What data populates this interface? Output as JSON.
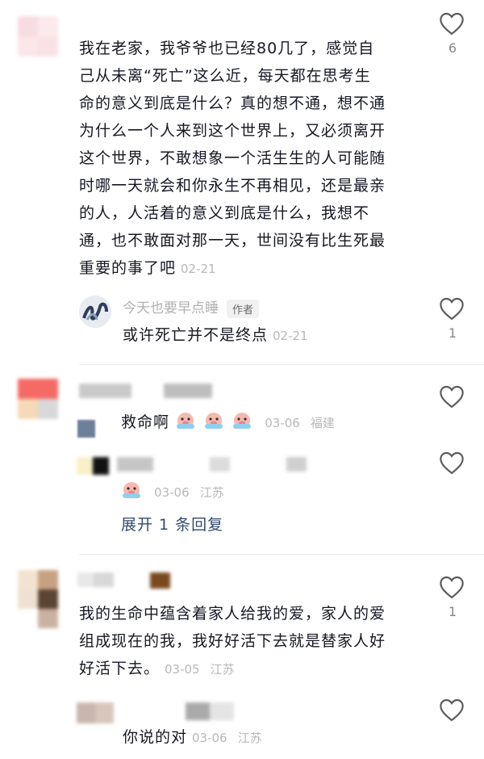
{
  "comments": [
    {
      "text_lines": [
        "我在老家，我爷爷也已经80几了，感觉自",
        "己从未离“死亡”这么近，每天都在思考生",
        "命的意义到底是什么？真的想不通，想不通",
        "为什么一个人来到这个世界上，又必须离开",
        "这个世界，不敢想象一个活生生的人可能随",
        "时哪一天就会和你永生不再相见，还是最亲",
        "的人，人活着的意义到底是什么，我想不",
        "通，也不敢面对那一天，世间没有比生死最",
        "重要的事了吧"
      ],
      "time": "02-21",
      "likes": "6",
      "reply": {
        "username": "今天也要早点睡",
        "tag": "作者",
        "text": "或许死亡并不是终点",
        "time": "02-21",
        "likes": "1"
      }
    },
    {
      "text": "救命啊",
      "time": "03-06",
      "location": "福建",
      "emoji": "crying-pig-emoji",
      "reply": {
        "time": "03-06",
        "location": "江苏",
        "emoji": "crying-pig-emoji"
      },
      "expand_label": "展开 1 条回复"
    },
    {
      "text_lines": [
        "我的生命中蕴含着家人给我的爱，家人的爱",
        "组成现在的我，我好好活下去就是替家人好",
        "好活下去。"
      ],
      "time": "03-05",
      "location": "江苏",
      "likes": "1",
      "reply": {
        "text": "你说的对",
        "time": "03-06",
        "location": "江苏"
      }
    }
  ],
  "colors": {
    "text": "#161823",
    "meta": "#b8b8b8",
    "link": "#334a6e",
    "heart_stroke": "#5c5c5c"
  }
}
